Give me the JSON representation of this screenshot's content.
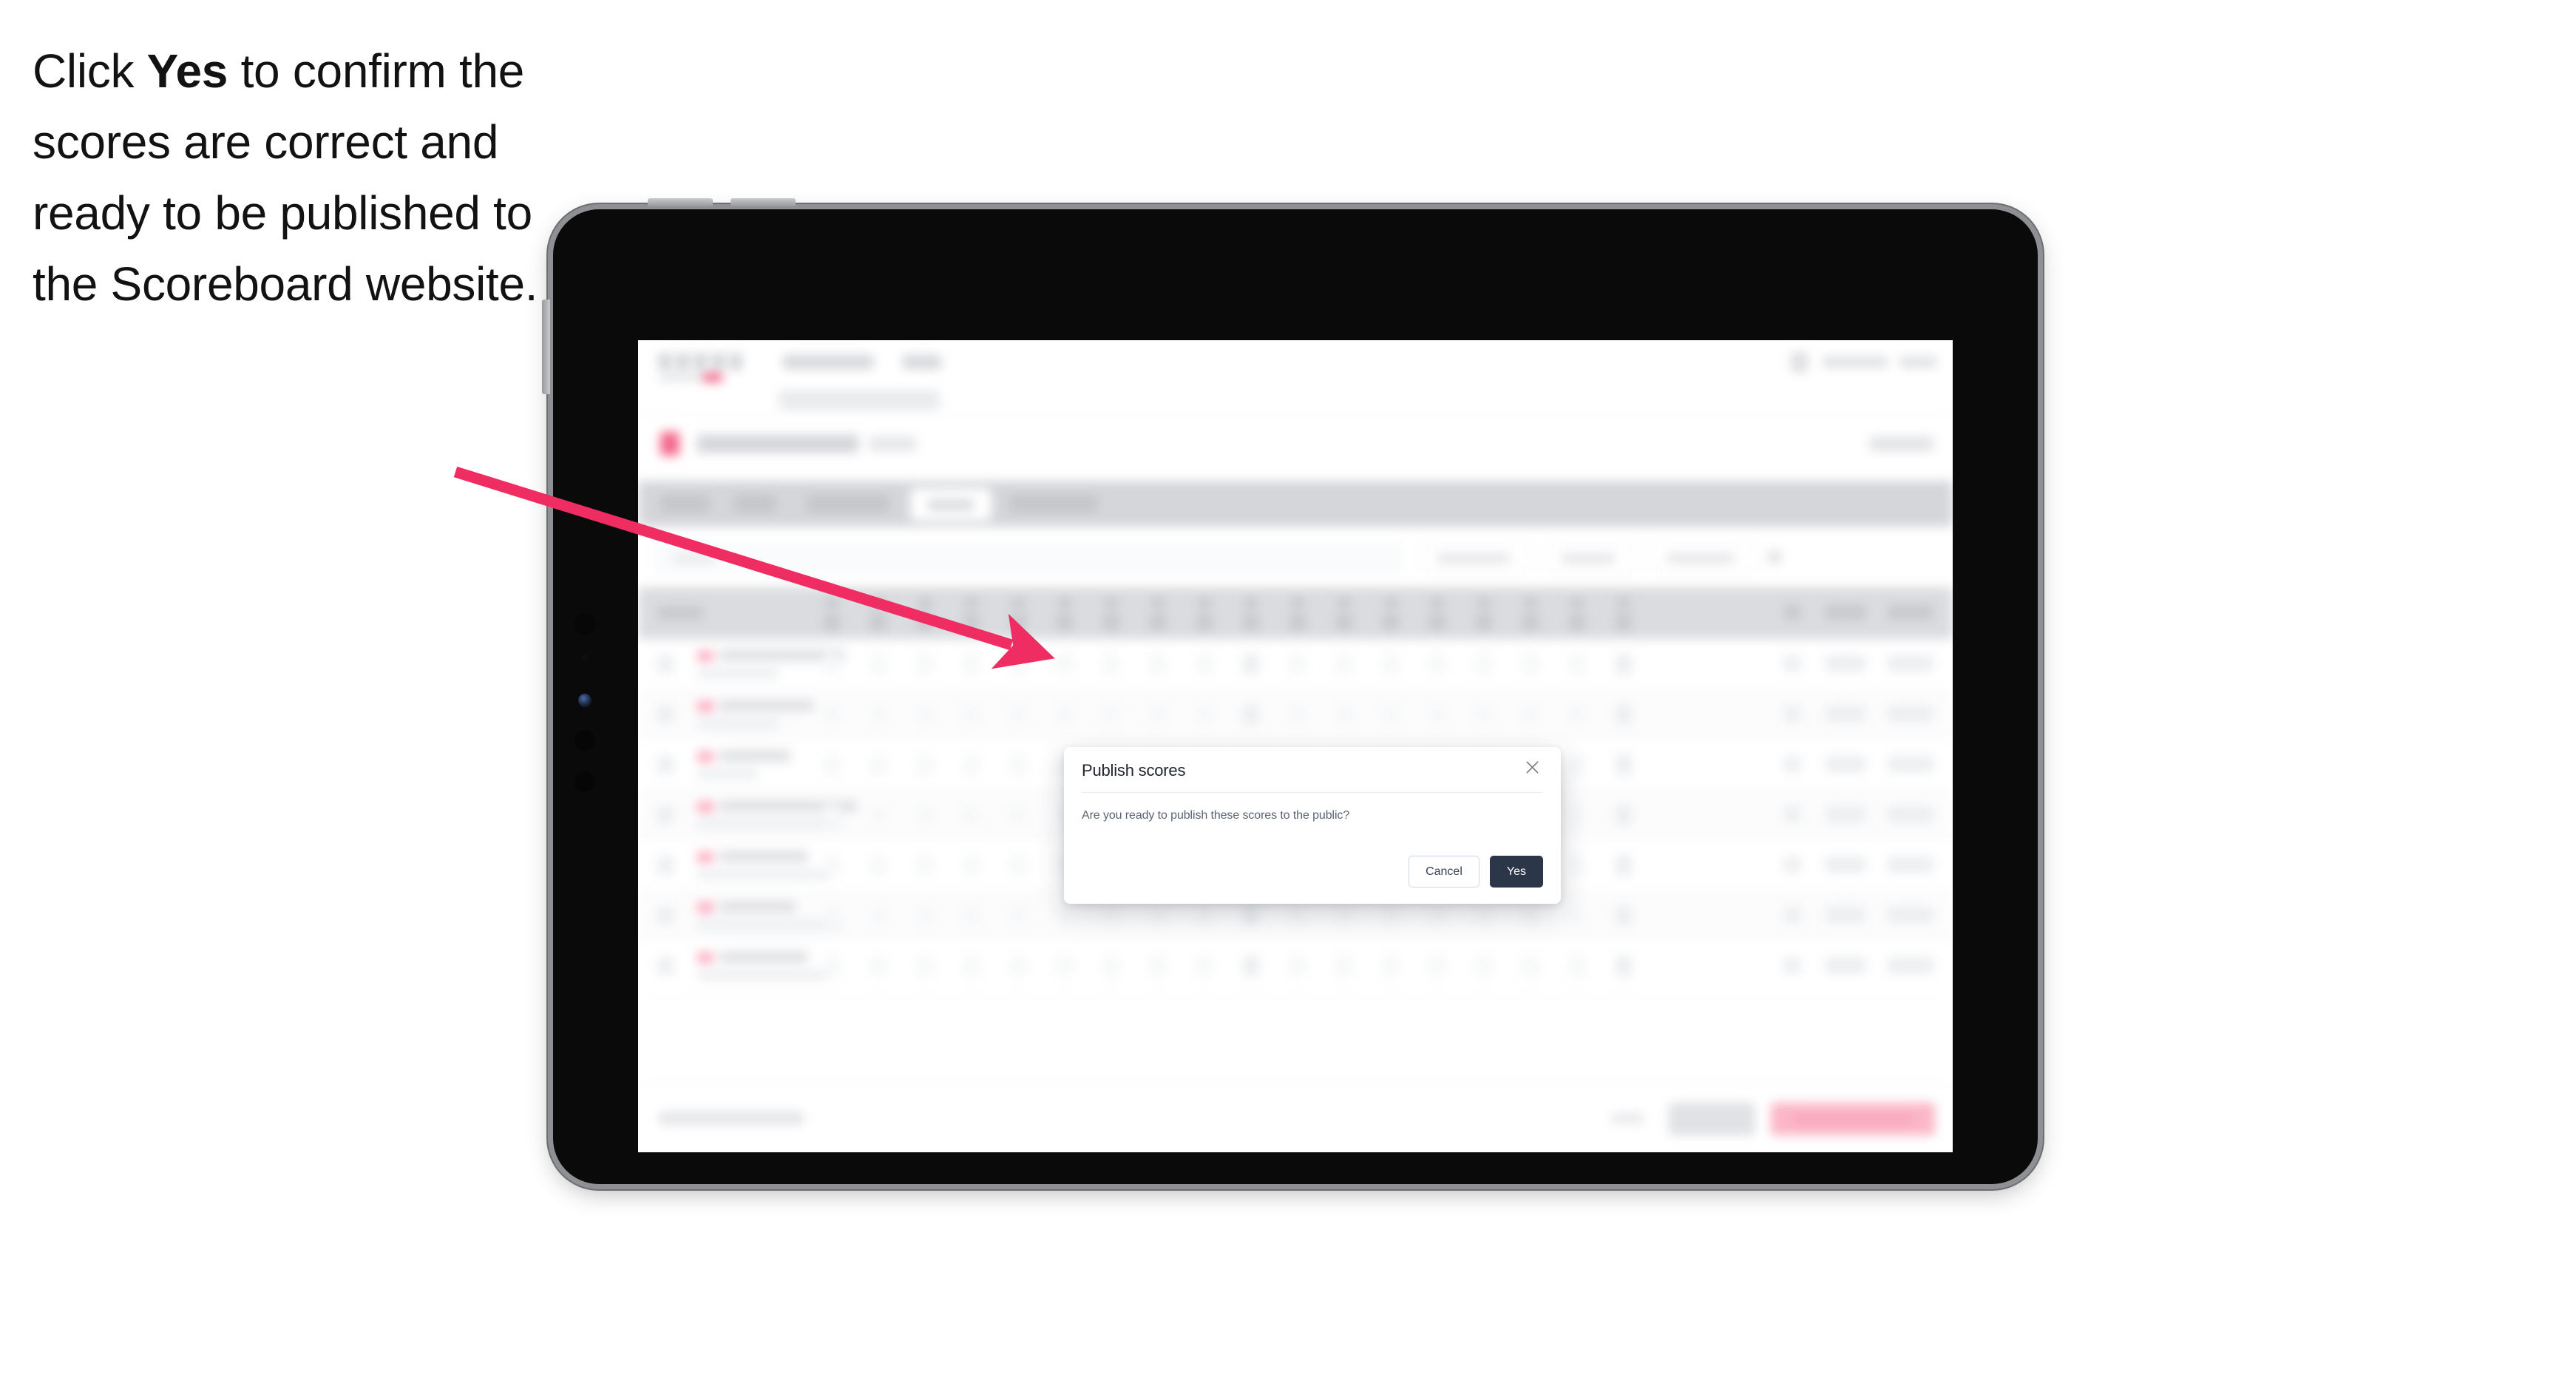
{
  "caption": {
    "before": "Click ",
    "bold": "Yes",
    "after": " to confirm the scores are correct and ready to be published to the Scoreboard website."
  },
  "modal": {
    "title": "Publish scores",
    "message": "Are you ready to publish these scores to the public?",
    "cancel_label": "Cancel",
    "confirm_label": "Yes",
    "close_icon": "close-icon"
  },
  "colors": {
    "annotation_arrow": "#ef2d63",
    "confirm_button_bg": "#2b3648",
    "cancel_button_border": "#cdd8ea",
    "tab_bar_bg": "#d3d5d9",
    "brand_pink": "#f4527c",
    "device_body": "#0a0a0a",
    "device_bezel": "#8f9093"
  },
  "device": {
    "type": "tablet",
    "orientation": "landscape"
  },
  "background_app": {
    "state": "blurred",
    "tab_rows": 7,
    "score_columns": 18
  }
}
